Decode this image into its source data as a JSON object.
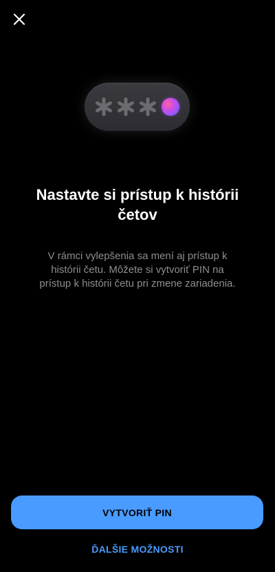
{
  "header": {
    "close_icon": "close-icon"
  },
  "illustration": {
    "icon": "pin-asterisks-icon",
    "asterisk_count": 3,
    "dot_color_start": "#ff5fa0",
    "dot_color_end": "#5a6bff"
  },
  "content": {
    "title": "Nastavte si prístup k histórii četov",
    "description": "V rámci vylepšenia sa mení aj prístup k histórii četu. Môžete si vytvoriť PIN na prístup k histórii četu pri zmene zariadenia."
  },
  "actions": {
    "primary_label": "VYTVORIŤ PIN",
    "secondary_label": "ĎALŠIE MOŽNOSTI"
  },
  "colors": {
    "background": "#000000",
    "accent": "#4a9bff",
    "text_primary": "#ffffff",
    "text_secondary": "#8e8e93"
  }
}
